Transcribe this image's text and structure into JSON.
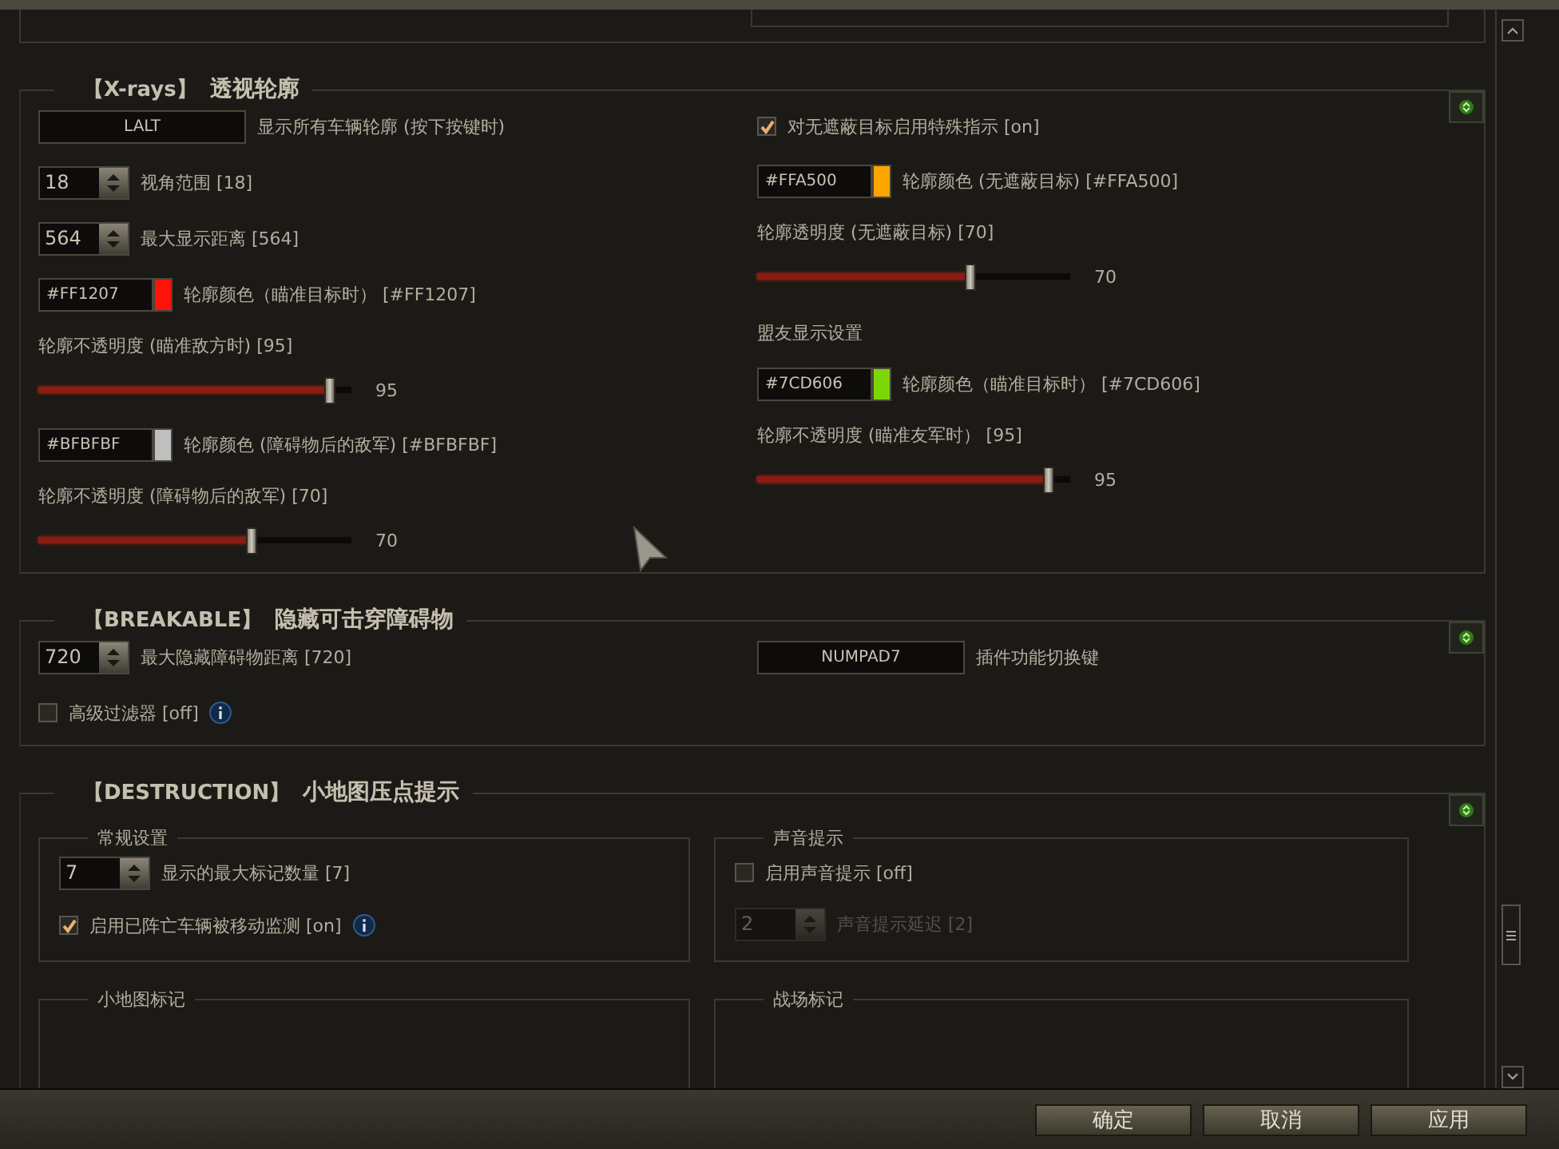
{
  "sections": [
    {
      "tag": "【X-rays】",
      "title": "透视轮廓",
      "columns": [
        [
          {
            "kind": "hotkey",
            "key": "LALT",
            "label": "显示所有车辆轮廓 (按下按键时)"
          },
          {
            "kind": "spinner",
            "value": "18",
            "label": "视角范围 [18]",
            "disabled": false
          },
          {
            "kind": "spinner",
            "value": "564",
            "label": "最大显示距离 [564]",
            "disabled": false
          },
          {
            "kind": "color",
            "value": "#FF1207",
            "color": "#ff1207",
            "label": "轮廓颜色（瞄准目标时） [#FF1207]"
          },
          {
            "kind": "slider",
            "label": "轮廓不透明度 (瞄准敌方时) [95]",
            "level": 0.93,
            "reading": "95"
          },
          {
            "kind": "color",
            "value": "#BFBFBF",
            "color": "#bfbfbf",
            "label": "轮廓颜色 (障碍物后的敌军) [#BFBFBF]"
          },
          {
            "kind": "slider",
            "label": "轮廓不透明度 (障碍物后的敌军) [70]",
            "level": 0.68,
            "reading": "70"
          }
        ],
        [
          {
            "kind": "checkbox",
            "text": "对无遮蔽目标启用特殊指示 [on]",
            "checked": true,
            "info": false
          },
          {
            "kind": "color",
            "value": "#FFA500",
            "color": "#ffa500",
            "label": "轮廓颜色 (无遮蔽目标) [#FFA500]"
          },
          {
            "kind": "slider",
            "label": "轮廓透明度 (无遮蔽目标) [70]",
            "level": 0.68,
            "reading": "70"
          },
          {
            "kind": "heading",
            "text": "盟友显示设置"
          },
          {
            "kind": "color",
            "value": "#7CD606",
            "color": "#7cd606",
            "label": "轮廓颜色（瞄准目标时） [#7CD606]"
          },
          {
            "kind": "slider",
            "label": "轮廓不透明度 (瞄准友军时） [95]",
            "level": 0.93,
            "reading": "95"
          }
        ]
      ]
    },
    {
      "tag": "【BREAKABLE】",
      "title": "隐藏可击穿障碍物",
      "columns": [
        [
          {
            "kind": "spinner",
            "value": "720",
            "label": "最大隐藏障碍物距离 [720]",
            "disabled": false
          },
          {
            "kind": "checkbox",
            "text": "高级过滤器 [off]",
            "checked": false,
            "info": true
          }
        ],
        [
          {
            "kind": "hotkey",
            "key": "NUMPAD7",
            "label": "插件功能切换键"
          }
        ]
      ]
    },
    {
      "tag": "【DESTRUCTION】",
      "title": "小地图压点提示",
      "groups": [
        {
          "title": "常规设置",
          "items": [
            {
              "kind": "spinner",
              "value": "7",
              "label": "显示的最大标记数量 [7]",
              "disabled": false
            },
            {
              "kind": "checkbox",
              "text": "启用已阵亡车辆被移动监测 [on]",
              "checked": true,
              "info": true
            }
          ]
        },
        {
          "title": "声音提示",
          "items": [
            {
              "kind": "checkbox",
              "text": "启用声音提示 [off]",
              "checked": false,
              "info": false
            },
            {
              "kind": "spinner",
              "value": "2",
              "label": "声音提示延迟 [2]",
              "disabled": true
            }
          ]
        },
        {
          "title": "小地图标记"
        },
        {
          "title": "战场标记"
        }
      ]
    }
  ],
  "buttons": [
    {
      "label": "确定"
    },
    {
      "label": "取消"
    },
    {
      "label": "应用"
    }
  ]
}
